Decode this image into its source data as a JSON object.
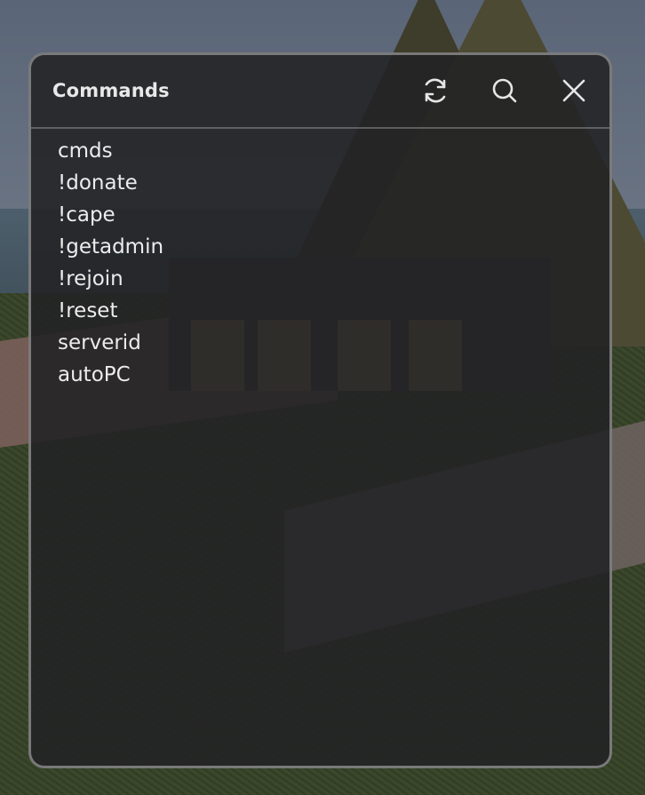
{
  "window": {
    "title": "Commands",
    "toolbar": {
      "refresh_icon": "refresh-icon",
      "search_icon": "search-icon",
      "close_icon": "close-icon"
    }
  },
  "commands": [
    "cmds",
    "!donate",
    "!cape",
    "!getadmin",
    "!rejoin",
    "!reset",
    "serverid",
    "autoPC"
  ],
  "colors": {
    "panel_bg": "#222224",
    "panel_border": "#969696",
    "text": "#ececec"
  }
}
